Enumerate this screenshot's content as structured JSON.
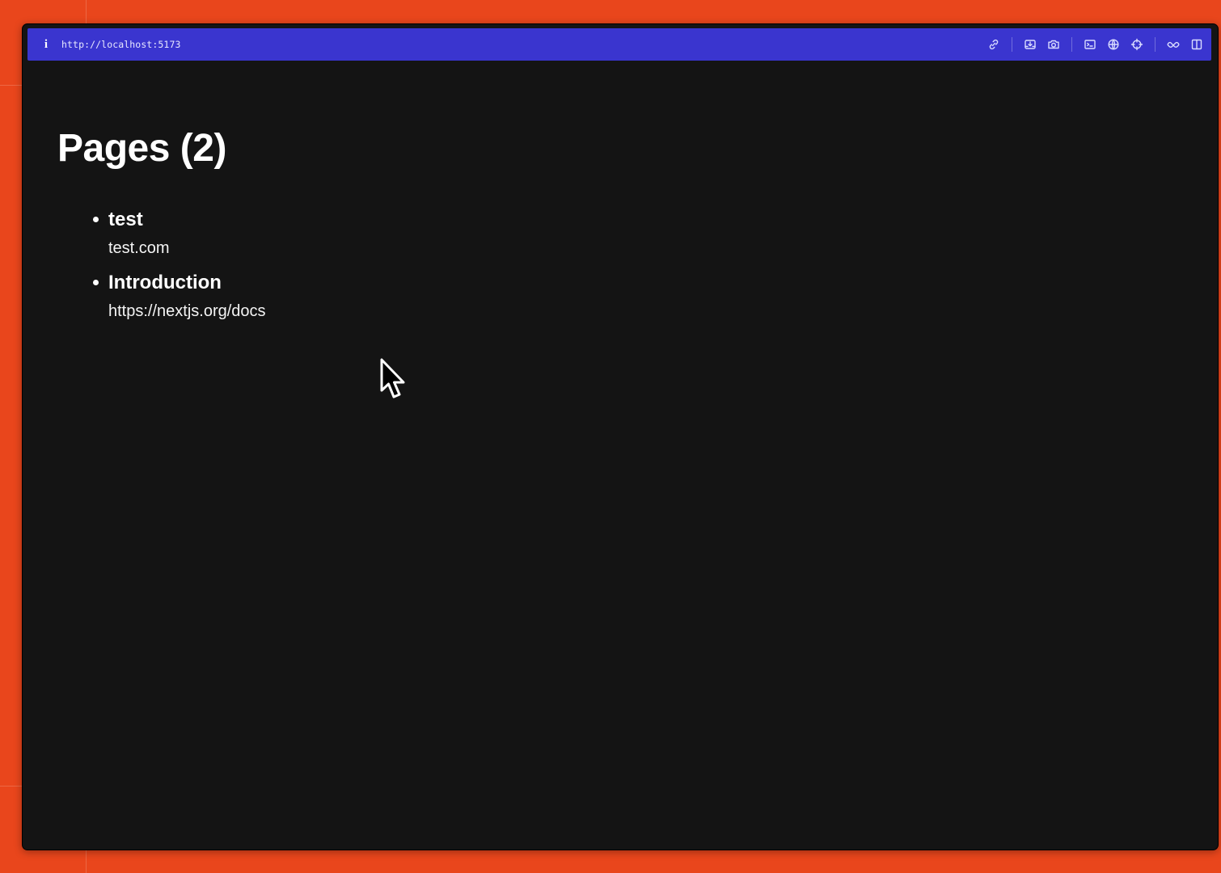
{
  "browser": {
    "url": "http://localhost:5173",
    "toolbar_icons": [
      "link-icon",
      "download-icon",
      "camera-icon",
      "terminal-icon",
      "globe-icon",
      "crosshair-icon",
      "extensions-icon",
      "split-view-icon"
    ]
  },
  "page": {
    "title": "Pages (2)",
    "items": [
      {
        "title": "test",
        "url": "test.com"
      },
      {
        "title": "Introduction",
        "url": "https://nextjs.org/docs"
      }
    ]
  },
  "colors": {
    "background": "#e9461c",
    "toolbar": "#3a35cf",
    "content_bg": "#141414",
    "text": "#ffffff"
  }
}
